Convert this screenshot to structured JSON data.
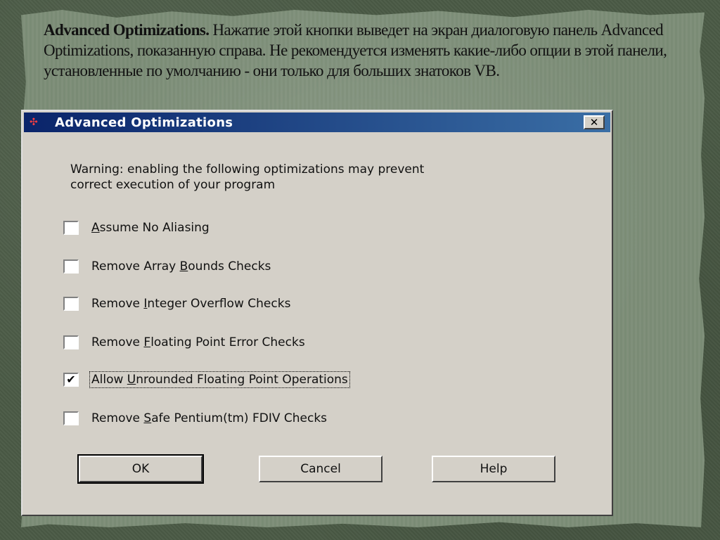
{
  "slide": {
    "heading_bold": "Advanced Optimizations.",
    "heading_rest": " Нажатие этой кнопки выведет на экран диалоговую панель Advanced Optimizations, показанную справа. Не рекомендуется изменять какие-либо опции в этой панели, установленные по умолчанию - они только для больших знатоков VB."
  },
  "dialog": {
    "title": "Advanced Optimizations",
    "close_glyph": "✕",
    "warning_line1": "Warning: enabling the following optimizations may prevent",
    "warning_line2": "correct execution of your program",
    "options": [
      {
        "pre": "",
        "u": "A",
        "post": "ssume No Aliasing",
        "checked": false
      },
      {
        "pre": "Remove Array ",
        "u": "B",
        "post": "ounds Checks",
        "checked": false
      },
      {
        "pre": "Remove ",
        "u": "I",
        "post": "nteger Overflow Checks",
        "checked": false
      },
      {
        "pre": "Remove ",
        "u": "F",
        "post": "loating Point Error Checks",
        "checked": false
      },
      {
        "pre": "Allow ",
        "u": "U",
        "post": "nrounded Floating Point Operations",
        "checked": true
      },
      {
        "pre": "Remove ",
        "u": "S",
        "post": "afe Pentium(tm) FDIV Checks",
        "checked": false
      }
    ],
    "check_mark": "✔",
    "buttons": {
      "ok": "OK",
      "cancel": "Cancel",
      "help": "Help"
    }
  }
}
